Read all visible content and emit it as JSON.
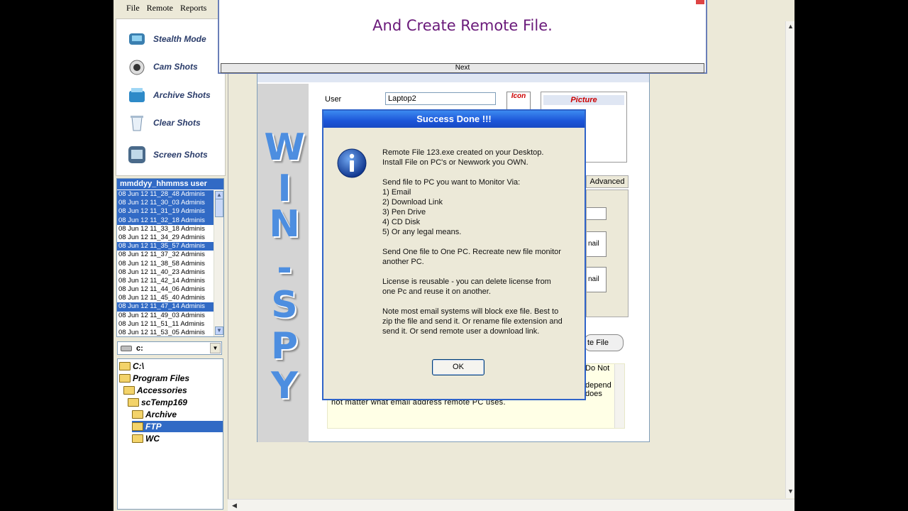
{
  "menu": {
    "file": "File",
    "remote": "Remote",
    "reports": "Reports"
  },
  "nav": [
    {
      "label": "Stealth Mode",
      "icon": "stealth-icon"
    },
    {
      "label": "Cam Shots",
      "icon": "camera-icon"
    },
    {
      "label": "Archive Shots",
      "icon": "archive-icon"
    },
    {
      "label": "Clear Shots",
      "icon": "trash-icon"
    },
    {
      "label": "Screen Shots",
      "icon": "screen-icon"
    }
  ],
  "list": {
    "header": "mmddyy_hhmmss user",
    "rows": [
      {
        "text": "08 Jun 12  11_28_48 Adminis",
        "selected": true
      },
      {
        "text": "08 Jun 12  11_30_03 Adminis",
        "selected": true
      },
      {
        "text": "08 Jun 12  11_31_19 Adminis",
        "selected": true
      },
      {
        "text": "08 Jun 12  11_32_18 Adminis",
        "selected": true
      },
      {
        "text": "08 Jun 12  11_33_18 Adminis",
        "selected": false
      },
      {
        "text": "08 Jun 12  11_34_29 Adminis",
        "selected": false
      },
      {
        "text": "08 Jun 12  11_35_57 Adminis",
        "selected": true
      },
      {
        "text": "08 Jun 12  11_37_32 Adminis",
        "selected": false
      },
      {
        "text": "08 Jun 12  11_38_58 Adminis",
        "selected": false
      },
      {
        "text": "08 Jun 12  11_40_23 Adminis",
        "selected": false
      },
      {
        "text": "08 Jun 12  11_42_14 Adminis",
        "selected": false
      },
      {
        "text": "08 Jun 12  11_44_06 Adminis",
        "selected": false
      },
      {
        "text": "08 Jun 12  11_45_40 Adminis",
        "selected": false
      },
      {
        "text": "08 Jun 12  11_47_14 Adminis",
        "selected": true
      },
      {
        "text": "08 Jun 12  11_49_03 Adminis",
        "selected": false
      },
      {
        "text": "08 Jun 12  11_51_11 Adminis",
        "selected": false
      },
      {
        "text": "08 Jun 12  11_53_05 Adminis",
        "selected": false
      }
    ]
  },
  "drive": {
    "value": "c:"
  },
  "folders": [
    {
      "label": "C:\\",
      "indent": 0,
      "selected": false
    },
    {
      "label": "Program Files",
      "indent": 0,
      "selected": false
    },
    {
      "label": "Accessories",
      "indent": 1,
      "selected": false
    },
    {
      "label": "scTemp169",
      "indent": 2,
      "selected": false
    },
    {
      "label": "Archive",
      "indent": 3,
      "selected": false
    },
    {
      "label": "FTP",
      "indent": 3,
      "selected": true
    },
    {
      "label": "WC",
      "indent": 3,
      "selected": false
    }
  ],
  "form": {
    "brand_letters": [
      "W",
      "I",
      "N",
      "-",
      "S",
      "P",
      "Y"
    ],
    "user_label": "User",
    "user_value": "Laptop2",
    "icon_label": "Icon",
    "picture_label": "Picture",
    "advanced_tab": "Advanced",
    "email_btn_1": "nail",
    "email_btn_2": "nail",
    "create_btn": "te File",
    "note_tail_1": "Do Not",
    "note_tail_2": "depend\ndoes",
    "note_tail_3": "not matter what email address remote PC uses."
  },
  "wizard": {
    "heading": "And Create Remote File.",
    "next": "Next"
  },
  "dialog": {
    "title": "Success Done !!!",
    "paragraphs": [
      "Remote File 123.exe created on your Desktop.\nInstall File on PC's or Newwork you OWN.",
      "Send file to PC you want to Monitor Via:\n1) Email\n2) Download Link\n3) Pen Drive\n4) CD Disk\n5) Or any legal means.",
      "Send One file to One PC. Recreate new file monitor\nanother PC.",
      "License is reusable - you can delete license from\none Pc and reuse it on another.",
      "Note most email systems will block exe file. Best to\nzip the file and send it. Or rename file extension and\nsend it. Or send remote user a download link."
    ],
    "ok": "OK"
  },
  "colors": {
    "selection": "#316ac5",
    "title_bar": "#1c55d8",
    "brand_blue": "#4d8ee0",
    "heading_purple": "#6a1a7a"
  }
}
